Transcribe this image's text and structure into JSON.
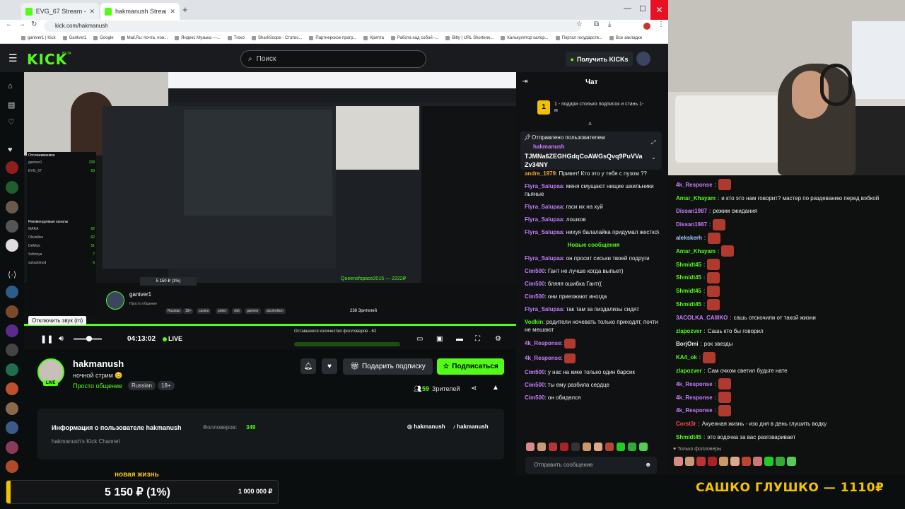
{
  "browser": {
    "tabs": [
      {
        "label": "EVG_67 Stream - Watch Live on Kick",
        "active": false
      },
      {
        "label": "hakmanush Stream - Watch Live on Kick",
        "active": true
      }
    ],
    "url": "kick.com/hakmanush",
    "bookmarks": [
      "gantver1 | Kick",
      "Gantver1",
      "Google",
      "Mail.Ru: почта, пои...",
      "Яндекс Музыка —...",
      "Trovo",
      "SharkScope - Статис...",
      "Партнерское прогр...",
      "Крипта",
      "Работа над собой -...",
      "Bitly | URL Shortene...",
      "Калькулятор калор...",
      "Портал государств...",
      "Все закладки"
    ]
  },
  "header": {
    "logo": "KICK",
    "logo_badge": "BETA",
    "search_placeholder": "Поиск",
    "get_kicks": "Получить KICKs"
  },
  "video": {
    "tooltip": "Отключить звук (m)",
    "time": "04:13:02",
    "live": "LIVE",
    "inner": {
      "streamer": "gantver1",
      "streamer_sub": "Просто общение",
      "tags": [
        "Russian",
        "18+",
        "casino",
        "poker",
        "slot",
        "gantver",
        "alcoholism"
      ],
      "queen": "Queenofspace2015 — 2222₽",
      "donation": "5 150 ₽ (1%)",
      "followers_goal": "Оставшееся количество фолловеров - 62",
      "viewers": "238 Зрителей",
      "sidebar_heading": "Отслеживаемое",
      "sidebar_items": [
        {
          "name": "gantver1",
          "count": "238"
        },
        {
          "name": "EVG_67",
          "count": "63"
        },
        {
          "name": "MARA",
          "count": "62"
        },
        {
          "name": "Oliviallive",
          "count": "62"
        },
        {
          "name": "DeMize",
          "count": "51"
        },
        {
          "name": "Selteriya",
          "count": "7"
        },
        {
          "name": "sukasblood",
          "count": "6"
        }
      ],
      "recommended": "Рекомендуемые каналы"
    }
  },
  "channel": {
    "name": "hakmanush",
    "title": "ночной стрим 😊",
    "category": "Просто общение",
    "tags": [
      "Russian",
      "18+"
    ],
    "live_badge": "LIVE",
    "gift_sub": "Подарить подписку",
    "subscribe": "Подписаться",
    "viewers": "59",
    "viewers_label": "Зрителей",
    "about_title": "Информация о пользователе hakmanush",
    "followers_label": "Фолловеров:",
    "followers": "349",
    "description": "hakmanush's Kick Channel",
    "socials": [
      "hakmanush",
      "hakmanush"
    ],
    "below_text": "новая жизнь"
  },
  "donation_bar": {
    "value": "5 150 ₽ (1%)",
    "goal": "1 000 000 ₽",
    "fraction": 0.01
  },
  "overlay_text": "САШКО ГЛУШКО — 1110₽",
  "kick_chat": {
    "title": "Чат",
    "sub_badge": "1",
    "sub_promo": "1 - подари столько подписок и стань 1-м",
    "pinned_label": "Отправлено пользователем",
    "pinned_user": "hakmanush",
    "pinned_msg": "TJMNa6ZEGHGdqCoAWGsQvq9PuVVaZv34NY",
    "messages": [
      {
        "user": "andre_1979",
        "text": "Привет! Кто это у тебя с пузом ??",
        "color": "#f5a623"
      },
      {
        "user": "Flyra_Salupaa",
        "text": "меня смущают нищие шкильники пьяные",
        "color": "#c77dff"
      },
      {
        "user": "Flyra_Salupaa",
        "text": "гаси их на хуй",
        "color": "#c77dff"
      },
      {
        "user": "Flyra_Salupaa",
        "text": "лошков",
        "color": "#c77dff"
      },
      {
        "user": "Flyra_Salupaa",
        "text": "нихуя балалайка придумал жестко\\",
        "color": "#c77dff"
      },
      {
        "separator": "Новые сообщения"
      },
      {
        "user": "Flyra_Salupaa",
        "text": "он просит сиськи твоей подруги",
        "color": "#c77dff"
      },
      {
        "user": "Cim500",
        "text": "Гант не лучше когда выпьет)",
        "color": "#c77dff"
      },
      {
        "user": "Cim500",
        "text": "бляяя ошибка Гант((",
        "color": "#c77dff"
      },
      {
        "user": "Cim500",
        "text": "они приезжают иногда",
        "color": "#c77dff"
      },
      {
        "user": "Flyra_Salupaa",
        "text": "так там за пиздализы сидят",
        "color": "#c77dff"
      },
      {
        "user": "Vodkin",
        "text": "родители ночевать только приходят, почти не мешают",
        "color": "#53fc18"
      },
      {
        "user": "4k_Response",
        "text": "",
        "color": "#c77dff",
        "emote": true
      },
      {
        "user": "4k_Response",
        "text": "",
        "color": "#c77dff",
        "emote": true
      },
      {
        "user": "Cim500",
        "text": "у нас на кике только один барсик",
        "color": "#c77dff"
      },
      {
        "user": "Cim500",
        "text": "ты ему разбила сердце",
        "color": "#c77dff"
      },
      {
        "user": "Cim500",
        "text": "он обиделся",
        "color": "#c77dff"
      }
    ],
    "input_placeholder": "Отправить сообщение"
  },
  "overlay_chat": {
    "messages": [
      {
        "user": "4k_Response",
        "text": "",
        "color": "#c77dff",
        "emote": true
      },
      {
        "user": "Amar_Khayam",
        "text": "и кто это нам говорит? мастер по раздеванию перед вэбкой",
        "color": "#53fc18"
      },
      {
        "user": "Dissan1987",
        "text": "режим ожидания",
        "color": "#c77dff"
      },
      {
        "user": "Dissan1987",
        "text": "",
        "color": "#c77dff",
        "emote": true
      },
      {
        "user": "alekskerh",
        "text": "",
        "color": "#9ad0ff",
        "emote": true
      },
      {
        "user": "Amar_Khayam",
        "text": "",
        "color": "#53fc18",
        "emote": true
      },
      {
        "user": "Shmidt45",
        "text": "",
        "color": "#53fc18",
        "emote": true
      },
      {
        "user": "Shmidt45",
        "text": "",
        "color": "#53fc18",
        "emote": true
      },
      {
        "user": "Shmidt45",
        "text": "",
        "color": "#53fc18",
        "emote": true
      },
      {
        "user": "Shmidt45",
        "text": "",
        "color": "#53fc18",
        "emote": true
      },
      {
        "user": "3ACOLKA_CAIIIKO",
        "text": "сашь отскочили от такой жизни",
        "color": "#c77dff"
      },
      {
        "user": "zlapozver",
        "text": "Сашь кто бы говорил",
        "color": "#53fc18"
      },
      {
        "user": "BorjOmi",
        "text": "рок звезды",
        "color": "#eeeeee"
      },
      {
        "user": "KA4_ok",
        "text": "",
        "color": "#53fc18",
        "emote": true
      },
      {
        "user": "zlapozver",
        "text": "Сам очком светил будьте нате",
        "color": "#53fc18"
      },
      {
        "user": "4k_Response",
        "text": "",
        "color": "#c77dff",
        "emote": true
      },
      {
        "user": "4k_Response",
        "text": "",
        "color": "#c77dff",
        "emote": true
      },
      {
        "user": "4k_Response",
        "text": "",
        "color": "#c77dff",
        "emote": true
      },
      {
        "user": "Corst3r",
        "text": "Ахуенная жизнь - изо дня в день глушить водку",
        "color": "#ff4d4d"
      },
      {
        "user": "Shmidt45",
        "text": "это водочка за вас разговаривает",
        "color": "#53fc18"
      }
    ],
    "followers_only": "Только фолловеры"
  }
}
